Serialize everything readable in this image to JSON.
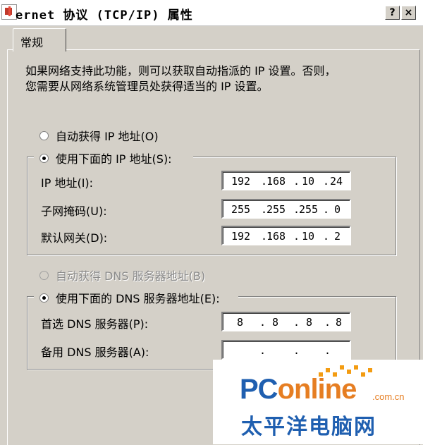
{
  "window": {
    "title": "ernet 协议 (TCP/IP) 属性",
    "help_button": "?",
    "close_button": "×"
  },
  "tabs": [
    {
      "label": "常规"
    }
  ],
  "description_line1": "如果网络支持此功能，则可以获取自动指派的 IP 设置。否则，",
  "description_line2": "您需要从网络系统管理员处获得适当的 IP 设置。",
  "ip_section": {
    "auto_label": "自动获得 IP 地址(O)",
    "manual_label": "使用下面的 IP 地址(S):",
    "fields": [
      {
        "label": "IP 地址(I):",
        "octets": [
          "192",
          "168",
          "10",
          "24"
        ]
      },
      {
        "label": "子网掩码(U):",
        "octets": [
          "255",
          "255",
          "255",
          "0"
        ]
      },
      {
        "label": "默认网关(D):",
        "octets": [
          "192",
          "168",
          "10",
          "2"
        ]
      }
    ]
  },
  "dns_section": {
    "auto_label": "自动获得 DNS 服务器地址(B)",
    "manual_label": "使用下面的 DNS 服务器地址(E):",
    "fields": [
      {
        "label": "首选 DNS 服务器(P):",
        "octets": [
          "8",
          "8",
          "8",
          "8"
        ]
      },
      {
        "label": "备用 DNS 服务器(A):",
        "octets": [
          "",
          "",
          "",
          ""
        ]
      }
    ]
  },
  "watermark": {
    "logo_text_a": "PC",
    "logo_text_b": "online",
    "domain": ".com.cn",
    "chinese": "太平洋电脑网"
  },
  "colors": {
    "dialog_bg": "#d4d0c8",
    "watermark_blue": "#1f5fb0",
    "watermark_orange": "#e67e22"
  }
}
